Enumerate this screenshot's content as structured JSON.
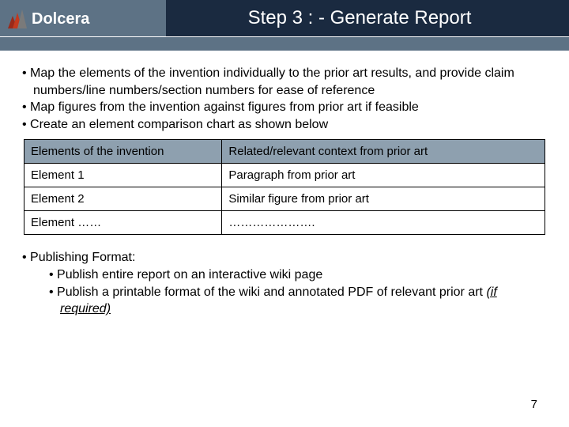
{
  "header": {
    "brand": "Dolcera",
    "title": "Step 3 : - Generate Report"
  },
  "bullets": [
    "Map the elements of the invention individually to the prior art results, and provide claim numbers/line numbers/section numbers for ease of reference",
    "Map figures from the invention against figures from prior art if feasible",
    "Create an element comparison chart as shown below"
  ],
  "table": {
    "header": {
      "left": "Elements of the invention",
      "right": "Related/relevant context from prior art"
    },
    "rows": [
      {
        "left": "Element 1",
        "right": "Paragraph from prior art"
      },
      {
        "left": "Element 2",
        "right": "Similar figure from prior art"
      },
      {
        "left": "Element ……",
        "right": "…………………."
      }
    ]
  },
  "publishing": {
    "heading": "Publishing Format:",
    "items": [
      "Publish entire report on an interactive wiki page",
      "Publish a printable format of the wiki and annotated PDF of relevant prior art "
    ],
    "italic_suffix": "(if required)"
  },
  "page_number": "7"
}
